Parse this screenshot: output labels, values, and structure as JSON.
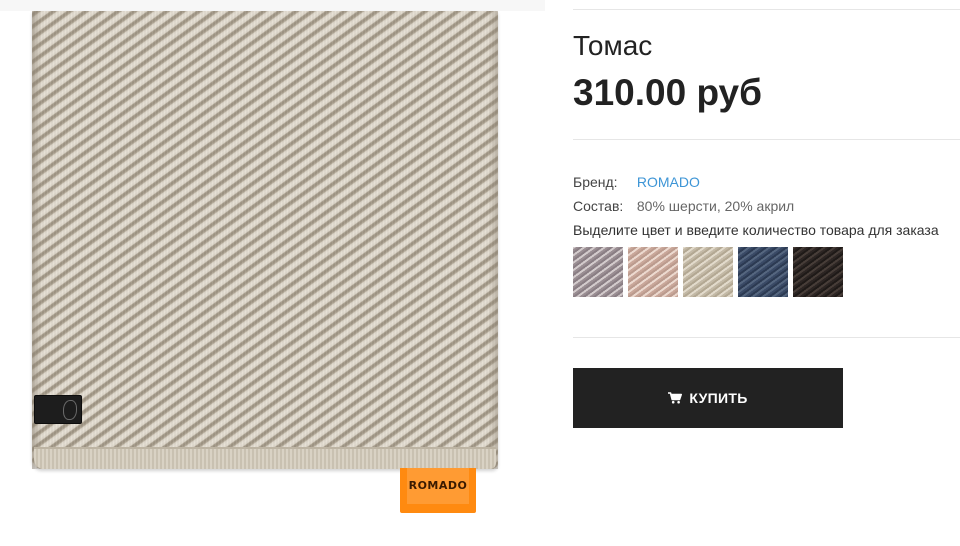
{
  "product": {
    "title": "Томас",
    "price": "310.00 руб",
    "specs": {
      "brand_label": "Бренд:",
      "brand_value": "ROMADO",
      "composition_label": "Состав:",
      "composition_value": "80% шерсти, 20% акрил"
    },
    "variant_instruction": "Выделите цвет и введите количество товара для заказа",
    "swatches": [
      {
        "color": "#9a8e93"
      },
      {
        "color": "#c9a79a"
      },
      {
        "color": "#c3b9a6"
      },
      {
        "color": "#3a4a66"
      },
      {
        "color": "#2c2523"
      }
    ],
    "buy_button": {
      "label": "КУПИТЬ",
      "icon": "cart-icon"
    }
  },
  "image": {
    "tag_text": "ROMADO"
  },
  "colors": {
    "brand_link": "#3d95d6",
    "button_bg": "#222222",
    "tag": "#ff8a10"
  }
}
